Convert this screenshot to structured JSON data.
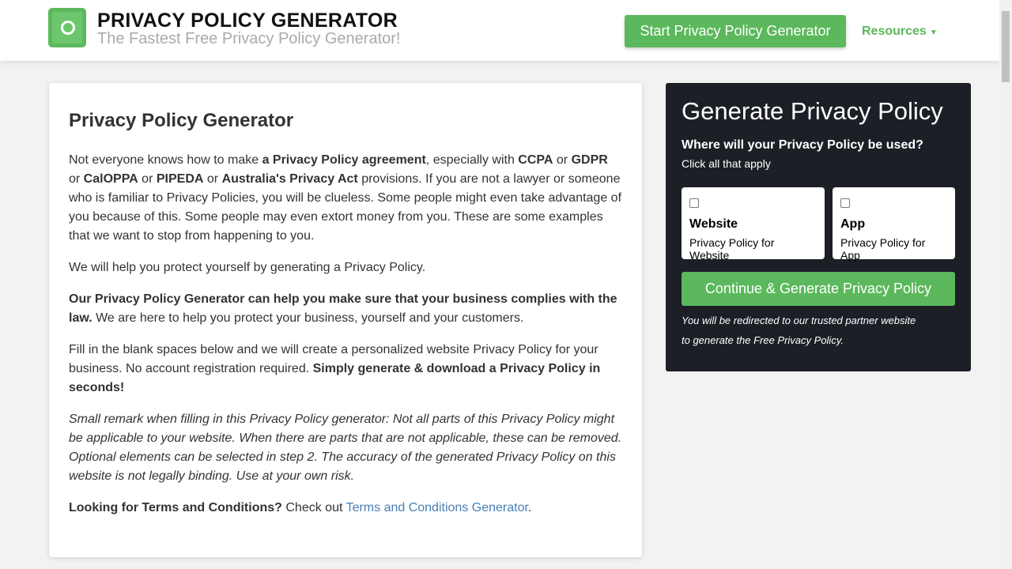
{
  "header": {
    "brand": "PRIVACY POLICY GENERATOR",
    "tagline": "The Fastest Free Privacy Policy Generator!",
    "start_button": "Start Privacy Policy Generator",
    "resources": "Resources",
    "resources_caret": "▼",
    "brand_color": "#5cb85c"
  },
  "main": {
    "title": "Privacy Policy Generator",
    "p1": [
      "Not everyone knows how to make ",
      "a Privacy Policy agreement",
      ", especially with ",
      "CCPA",
      " or ",
      "GDPR",
      " or ",
      "CalOPPA",
      " or ",
      "PIPEDA",
      " or ",
      "Australia's Privacy Act",
      " provisions. If you are not a lawyer or someone who is familiar to Privacy Policies, you will be clueless. Some people might even take advantage of you because of this. Some people may even extort money from you. These are some examples that we want to stop from happening to you."
    ],
    "p2": "We will help you protect yourself by generating a Privacy Policy.",
    "p3": [
      "Our Privacy Policy Generator can help you make sure that your business complies with the law.",
      " We are here to help you protect your business, yourself and your customers."
    ],
    "p4": [
      "Fill in the blank spaces below and we will create a personalized website Privacy Policy for your business. No account registration required. ",
      "Simply generate & download a Privacy Policy in seconds!"
    ],
    "p5": "Small remark when filling in this Privacy Policy generator: Not all parts of this Privacy Policy might be applicable to your website. When there are parts that are not applicable, these can be removed. Optional elements can be selected in step 2. The accuracy of the generated Privacy Policy on this website is not legally binding. Use at your own risk.",
    "p6": [
      "Looking for Terms and Conditions?",
      " Check out ",
      "Terms and Conditions Generator",
      "."
    ]
  },
  "panel": {
    "title": "Generate Privacy Policy",
    "question": "Where will your Privacy Policy be used?",
    "hint": "Click all that apply",
    "options": [
      {
        "label": "Website",
        "desc": "Privacy Policy for Website",
        "checked": false
      },
      {
        "label": "App",
        "desc": "Privacy Policy for App",
        "checked": false
      }
    ],
    "continue": "Continue & Generate Privacy Policy",
    "note1": "You will be redirected to our trusted partner website",
    "note2": "to generate the Free Privacy Policy."
  }
}
